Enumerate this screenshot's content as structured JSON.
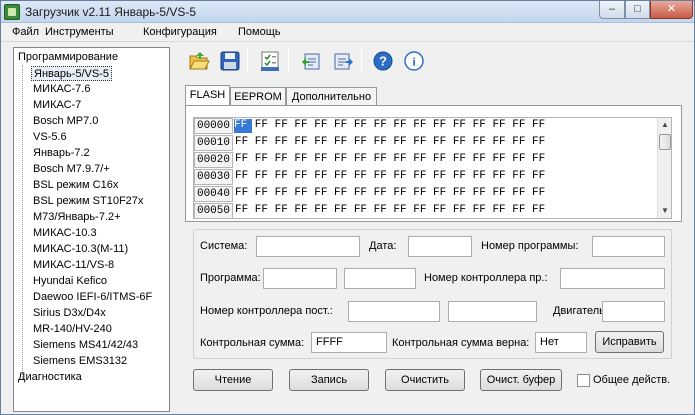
{
  "window": {
    "title": "Загрузчик v2.11 Январь-5/VS-5",
    "min_glyph": "–",
    "max_glyph": "□",
    "close_glyph": "✕"
  },
  "menu": [
    "Файл",
    "Инструменты",
    "Конфигурация",
    "Помощь"
  ],
  "tree": {
    "root": "Программирование",
    "items": [
      "Январь-5/VS-5",
      "МИКАС-7.6",
      "МИКАС-7",
      "Bosch MP7.0",
      "VS-5.6",
      "Январь-7.2",
      "Bosch M7.9.7/+",
      "BSL режим C16x",
      "BSL режим ST10F27x",
      "М73/Январь-7.2+",
      "МИКАС-10.3",
      "МИКАС-10.3(М-11)",
      "МИКАС-11/VS-8",
      "Hyundai Kefico",
      "Daewoo IEFI-6/ITMS-6F",
      "Sirius D3x/D4x",
      "MR-140/HV-240",
      "Siemens MS41/42/43",
      "Siemens EMS3132"
    ],
    "footer": "Диагностика",
    "selected": "Январь-5/VS-5"
  },
  "toolbar": {
    "icons": [
      "open-folder-icon",
      "save-icon",
      "checklist-icon",
      "download-icon",
      "upload-icon",
      "help-icon",
      "info-icon"
    ]
  },
  "tabs": [
    "FLASH",
    "EEPROM",
    "Дополнительно"
  ],
  "hex": {
    "rows": [
      {
        "addr": "00000",
        "bytes": "FF FF FF FF FF FF FF FF FF FF FF FF FF FF FF FF"
      },
      {
        "addr": "00010",
        "bytes": "FF FF FF FF FF FF FF FF FF FF FF FF FF FF FF FF"
      },
      {
        "addr": "00020",
        "bytes": "FF FF FF FF FF FF FF FF FF FF FF FF FF FF FF FF"
      },
      {
        "addr": "00030",
        "bytes": "FF FF FF FF FF FF FF FF FF FF FF FF FF FF FF FF"
      },
      {
        "addr": "00040",
        "bytes": "FF FF FF FF FF FF FF FF FF FF FF FF FF FF FF FF"
      },
      {
        "addr": "00050",
        "bytes": "FF FF FF FF FF FF FF FF FF FF FF FF FF FF FF FF"
      }
    ],
    "cursor": "FF"
  },
  "info": {
    "sistema_label": "Система:",
    "data_label": "Дата:",
    "nomer_programmy_label": "Номер программы:",
    "programma_label": "Программа:",
    "nomer_kontrollera_pr_label": "Номер контроллера пр.:",
    "nomer_kontrollera_post_label": "Номер контроллера пост.:",
    "dvigatel_label": "Двигатель:",
    "checksum_label": "Контрольная сумма:",
    "checksum_value": "FFFF",
    "checksum_ok_label": "Контрольная сумма верна:",
    "checksum_ok_value": "Нет",
    "fix_button": "Исправить"
  },
  "actions": {
    "read": "Чтение",
    "write": "Запись",
    "clear": "Очистить",
    "clear_buffer": "Очист. буфер",
    "common_action": "Общее действ."
  }
}
